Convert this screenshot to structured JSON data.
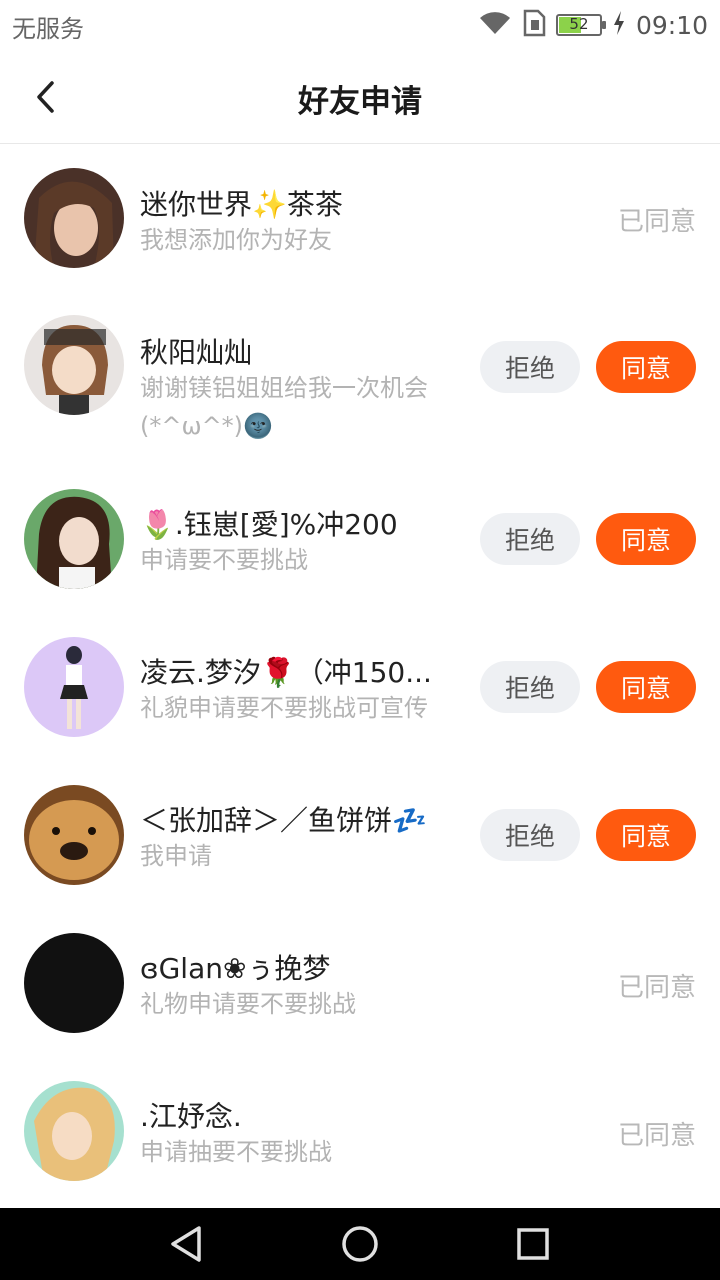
{
  "status_bar": {
    "carrier": "无服务",
    "time": "09:10",
    "battery_level": "52",
    "icons": [
      "wifi-icon",
      "sim-icon",
      "battery-icon",
      "charging-icon"
    ]
  },
  "header": {
    "title": "好友申请",
    "back_icon": "chevron-left-icon"
  },
  "buttons": {
    "reject": "拒绝",
    "accept": "同意"
  },
  "requests": [
    {
      "name": "迷你世界✨茶茶",
      "message": "我想添加你为好友",
      "status": "已同意",
      "avatar_color": "#6b4a3a"
    },
    {
      "name": "秋阳灿灿",
      "message": "谢谢镁铝姐姐给我一次机会(*^ω^*)🌚",
      "status": "",
      "avatar_color": "#c9a88a"
    },
    {
      "name": "🌷.钰崽[愛]%冲200",
      "message": "申请要不要挑战",
      "status": "",
      "avatar_color": "#5a3b2e"
    },
    {
      "name": "凌云.梦汐🌹（冲150...",
      "message": "礼貌申请要不要挑战可宣传",
      "status": "",
      "avatar_color": "#d9c6f5"
    },
    {
      "name": "＜张加辞＞／鱼饼饼💤",
      "message": "我申请",
      "status": "",
      "avatar_color": "#c98a3a"
    },
    {
      "name": "ɞGlan❀ぅ挽梦",
      "message": "礼物申请要不要挑战",
      "status": "已同意",
      "avatar_color": "#111111"
    },
    {
      "name": ".江妤念.",
      "message": "申请抽要不要挑战",
      "status": "已同意",
      "avatar_color": "#9fd8c8"
    }
  ],
  "nav": {
    "icons": [
      "back-triangle-icon",
      "home-circle-icon",
      "recents-square-icon"
    ]
  },
  "colors": {
    "accent": "#ff5a0f",
    "muted_text": "#b3b3b3"
  }
}
